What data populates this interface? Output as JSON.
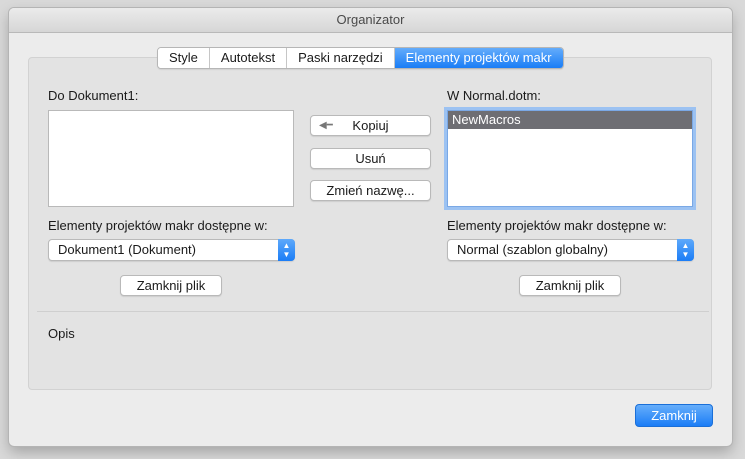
{
  "window": {
    "title": "Organizator"
  },
  "tabs": [
    {
      "label": "Style"
    },
    {
      "label": "Autotekst"
    },
    {
      "label": "Paski narzędzi"
    },
    {
      "label": "Elementy projektów makr",
      "active": true
    }
  ],
  "left": {
    "heading": "Do Dokument1:",
    "items": [],
    "available_label": "Elementy projektów makr dostępne w:",
    "available_value": "Dokument1 (Dokument)",
    "close_file": "Zamknij plik"
  },
  "right": {
    "heading": "W Normal.dotm:",
    "items": [
      {
        "label": "NewMacros",
        "selected": true
      }
    ],
    "available_label": "Elementy projektów makr dostępne w:",
    "available_value": "Normal (szablon globalny)",
    "close_file": "Zamknij plik"
  },
  "actions": {
    "copy": "Kopiuj",
    "copy_arrow": "◀━",
    "delete": "Usuń",
    "rename": "Zmień nazwę..."
  },
  "description": {
    "label": "Opis"
  },
  "footer": {
    "close": "Zamknij"
  },
  "colors": {
    "accent": "#1a7df6",
    "selection": "#6e6e73"
  }
}
